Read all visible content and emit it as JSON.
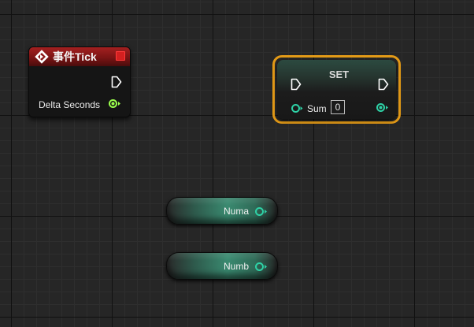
{
  "graph": {
    "nodes": {
      "event_tick": {
        "title": "事件Tick",
        "header_color": "#a32020",
        "event_icon": "event-diamond-icon",
        "delegate_pin_color": "#d42020",
        "exec_out_icon": "exec-pin-icon",
        "outputs": [
          {
            "label": "Delta Seconds",
            "type_color": "#9bff4d",
            "icon": "float-pin-icon"
          }
        ]
      },
      "set_sum": {
        "title": "SET",
        "selected": true,
        "selection_color": "#e39a17",
        "exec_in_icon": "exec-pin-icon",
        "exec_out_icon": "exec-pin-icon",
        "input": {
          "label": "Sum",
          "value": "0",
          "type_color": "#2ed1a6",
          "icon": "integer-pin-icon"
        },
        "output": {
          "type_color": "#2ed1a6",
          "icon": "integer-pin-icon"
        }
      },
      "get_numa": {
        "label": "Numa",
        "type_color": "#2ed1a6",
        "icon": "integer-pin-icon"
      },
      "get_numb": {
        "label": "Numb",
        "type_color": "#2ed1a6",
        "icon": "integer-pin-icon"
      }
    }
  }
}
